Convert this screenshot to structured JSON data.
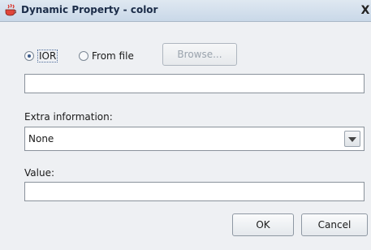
{
  "window": {
    "title": "Dynamic Property - color",
    "close_glyph": "X"
  },
  "source": {
    "options": [
      {
        "label": "IOR",
        "selected": true
      },
      {
        "label": "From file",
        "selected": false
      }
    ],
    "browse_label": "Browse...",
    "ior_value": ""
  },
  "extra": {
    "label": "Extra information:",
    "selected": "None"
  },
  "value": {
    "label": "Value:",
    "current": ""
  },
  "buttons": {
    "ok": "OK",
    "cancel": "Cancel"
  },
  "icons": {
    "app": "java-cup-icon",
    "close": "close-icon",
    "dropdown": "chevron-down-icon"
  }
}
